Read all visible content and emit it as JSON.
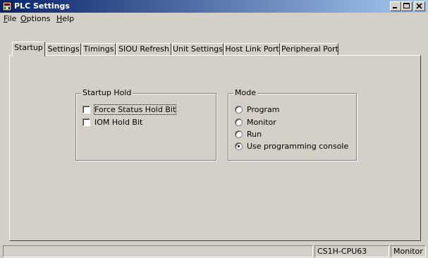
{
  "window": {
    "title": "PLC Settings",
    "icon": "plc-app-icon",
    "controls": [
      "minimize-icon",
      "maximize-icon",
      "close-icon"
    ]
  },
  "menu": [
    {
      "label": "File",
      "mnemonic": "F",
      "rest": "ile"
    },
    {
      "label": "Options",
      "mnemonic": "O",
      "rest": "ptions"
    },
    {
      "label": "Help",
      "mnemonic": "H",
      "rest": "elp"
    }
  ],
  "tabs": [
    {
      "label": "Startup",
      "active": true
    },
    {
      "label": "Settings",
      "active": false
    },
    {
      "label": "Timings",
      "active": false
    },
    {
      "label": "SIOU Refresh",
      "active": false
    },
    {
      "label": "Unit Settings",
      "active": false
    },
    {
      "label": "Host Link Port",
      "active": false
    },
    {
      "label": "Peripheral Port",
      "active": false
    }
  ],
  "startup_hold": {
    "label": "Startup Hold",
    "options": [
      {
        "label": "Force Status Hold Bit",
        "checked": false
      },
      {
        "label": "IOM Hold Bit",
        "checked": false
      }
    ]
  },
  "mode": {
    "label": "Mode",
    "selected": "Use programming console",
    "options": [
      {
        "label": "Program"
      },
      {
        "label": "Monitor"
      },
      {
        "label": "Run"
      },
      {
        "label": "Use programming console"
      }
    ]
  },
  "status_bar": {
    "cpu": "CS1H-CPU63",
    "mode": "Monitor"
  }
}
